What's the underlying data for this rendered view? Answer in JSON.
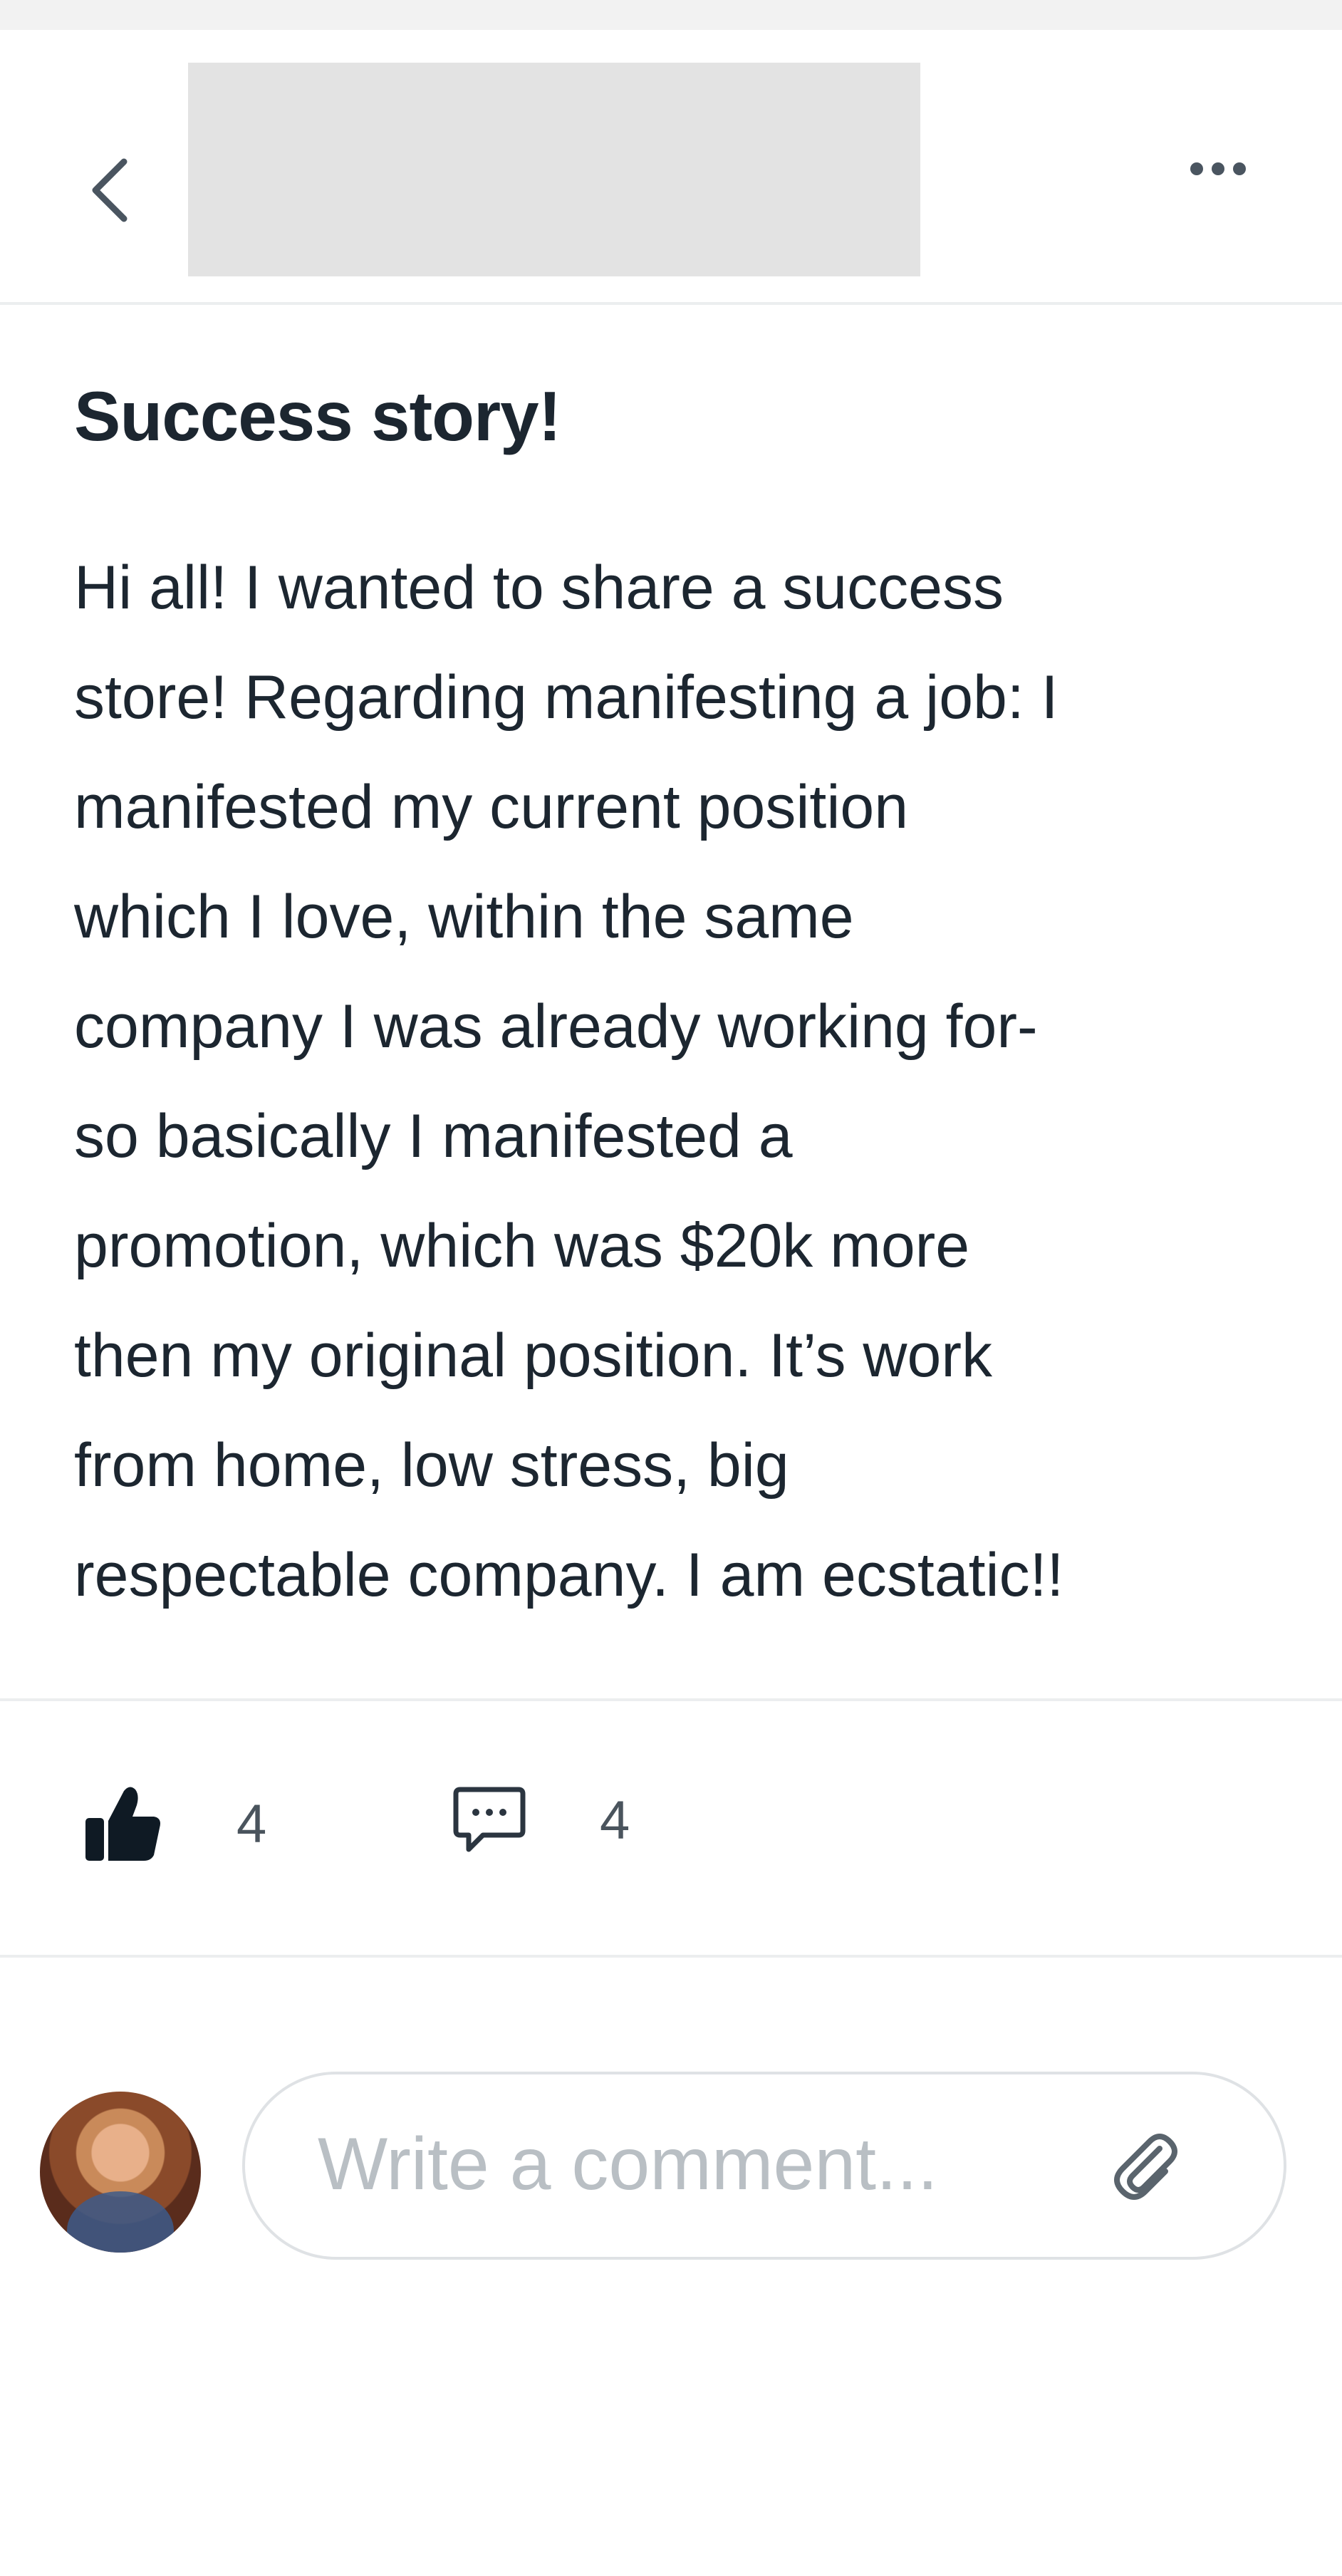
{
  "header": {
    "back_icon": "chevron-left-icon",
    "more_icon": "more-horizontal-icon"
  },
  "post": {
    "title": "Success story!",
    "body": "Hi all! I wanted to share a success\nstore! Regarding manifesting a job: I\nmanifested my current position\nwhich I love, within the same\ncompany I was already working for-\nso basically I manifested a\npromotion, which was $20k more\nthen my original position. It’s work\nfrom home, low stress, big\nrespectable company. I am ecstatic!!"
  },
  "reactions": {
    "like_icon": "thumbs-up-icon",
    "like_count": "4",
    "comment_icon": "comment-bubble-icon",
    "comment_count": "4"
  },
  "comment_bar": {
    "placeholder": "Write a comment...",
    "attach_icon": "paperclip-icon"
  },
  "colors": {
    "text": "#1c2630",
    "muted": "#4a545d",
    "divider": "#eceeef",
    "placeholder": "#b9bfc4"
  }
}
